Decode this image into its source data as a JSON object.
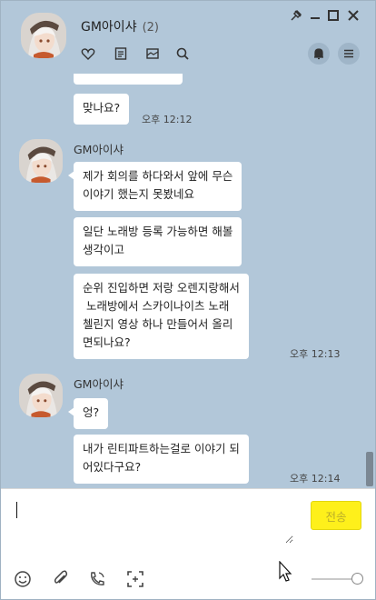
{
  "header": {
    "title": "GM아이샤",
    "member_count": "(2)",
    "window_controls": [
      "pin-icon",
      "minimize-icon",
      "maximize-icon",
      "close-icon"
    ],
    "toolbar_icons": [
      "heart-icon",
      "document-icon",
      "album-icon",
      "search-icon"
    ],
    "right_icons": [
      "bell-icon",
      "menu-icon"
    ]
  },
  "chat": {
    "messages": [
      {
        "text": "맞나요?",
        "time": "오후 12:12"
      },
      {
        "sender": "GM아이샤"
      },
      {
        "text_lines": [
          "제가 회의를 하다와서 앞에 무슨",
          "이야기 했는지 못봤네요"
        ]
      },
      {
        "text_lines": [
          "일단 노래방 등록 가능하면 해볼",
          "생각이고"
        ]
      },
      {
        "text_lines": [
          "순위 진입하면 저랑 오렌지랑해서",
          " 노래방에서 스카이나이츠 노래",
          "첼린지 영상 하나 만들어서 올리",
          "면되나요?"
        ],
        "time": "오후 12:13"
      },
      {
        "sender": "GM아이샤"
      },
      {
        "text": "엉?"
      },
      {
        "text_lines": [
          "내가 린티파트하는걸로 이야기 되",
          "어있다구요?"
        ],
        "time": "오후 12:14"
      }
    ]
  },
  "input": {
    "value": "",
    "send_label": "전송",
    "bottom_icons": [
      "emoji-icon",
      "attach-icon",
      "call-icon",
      "capture-icon"
    ],
    "slider_value": 1.0
  },
  "colors": {
    "chat_bg": "#b2c7d9",
    "bubble": "#ffffff",
    "send_button": "#fef01b"
  }
}
